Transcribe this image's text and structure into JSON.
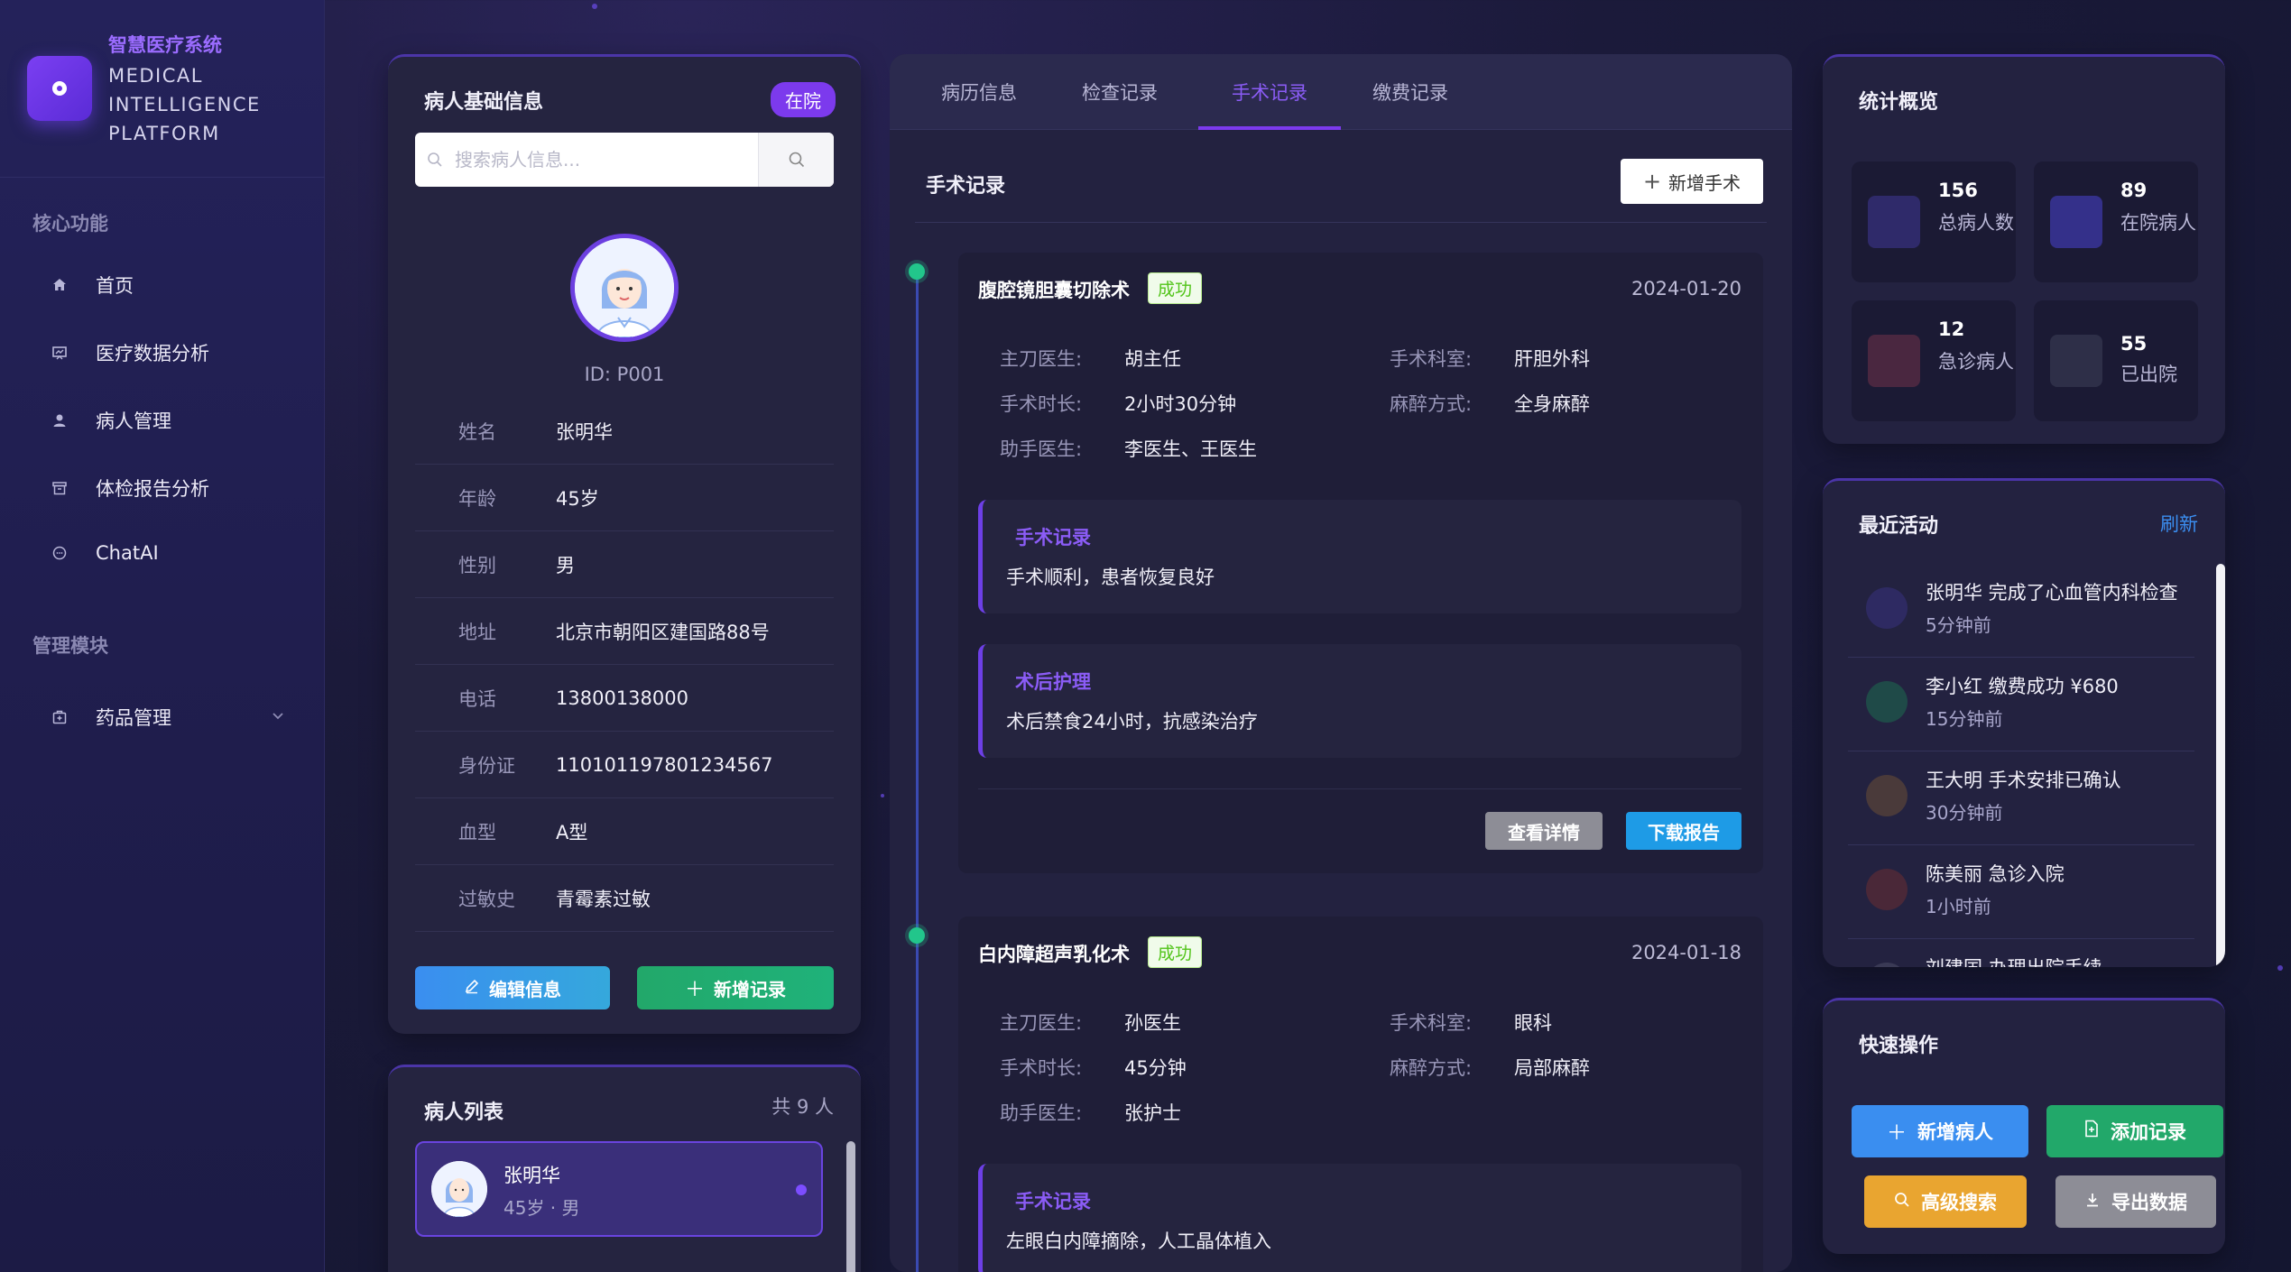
{
  "brand": {
    "title": "智慧医疗系统",
    "subtitle": "MEDICAL INTELLIGENCE PLATFORM"
  },
  "sidebar": {
    "section_core": "核心功能",
    "items": [
      {
        "label": "首页",
        "icon": "home-icon"
      },
      {
        "label": "医疗数据分析",
        "icon": "chart-icon"
      },
      {
        "label": "病人管理",
        "icon": "user-icon"
      },
      {
        "label": "体检报告分析",
        "icon": "report-icon"
      },
      {
        "label": "ChatAI",
        "icon": "chat-icon"
      }
    ],
    "section_manage": "管理模块",
    "manage_items": [
      {
        "label": "药品管理",
        "icon": "medicine-icon"
      }
    ]
  },
  "patient_info": {
    "title": "病人基础信息",
    "status": "在院",
    "search_placeholder": "搜索病人信息...",
    "id": "ID: P001",
    "fields": [
      {
        "k": "姓名",
        "v": "张明华"
      },
      {
        "k": "年龄",
        "v": "45岁"
      },
      {
        "k": "性别",
        "v": "男"
      },
      {
        "k": "地址",
        "v": "北京市朝阳区建国路88号"
      },
      {
        "k": "电话",
        "v": "13800138000"
      },
      {
        "k": "身份证",
        "v": "110101197801234567"
      },
      {
        "k": "血型",
        "v": "A型"
      },
      {
        "k": "过敏史",
        "v": "青霉素过敏"
      }
    ],
    "edit_label": "编辑信息",
    "add_label": "新增记录"
  },
  "patient_list": {
    "title": "病人列表",
    "count": "共 9 人",
    "items": [
      {
        "name": "张明华",
        "meta": "45岁 · 男"
      }
    ]
  },
  "tabs": [
    "病历信息",
    "检查记录",
    "手术记录",
    "缴费记录"
  ],
  "active_tab": "手术记录",
  "surgery": {
    "title": "手术记录",
    "add_label": "新增手术",
    "records": [
      {
        "name": "腹腔镜胆囊切除术",
        "status": "成功",
        "date": "2024-01-20",
        "surgeon_k": "主刀医生:",
        "surgeon": "胡主任",
        "dept_k": "手术科室:",
        "dept": "肝胆外科",
        "duration_k": "手术时长:",
        "duration": "2小时30分钟",
        "anesthesia_k": "麻醉方式:",
        "anesthesia": "全身麻醉",
        "assistant_k": "助手医生:",
        "assistant": "李医生、王医生",
        "note1_title": "手术记录",
        "note1": "手术顺利，患者恢复良好",
        "note2_title": "术后护理",
        "note2": "术后禁食24小时，抗感染治疗",
        "detail_label": "查看详情",
        "download_label": "下载报告"
      },
      {
        "name": "白内障超声乳化术",
        "status": "成功",
        "date": "2024-01-18",
        "surgeon_k": "主刀医生:",
        "surgeon": "孙医生",
        "dept_k": "手术科室:",
        "dept": "眼科",
        "duration_k": "手术时长:",
        "duration": "45分钟",
        "anesthesia_k": "麻醉方式:",
        "anesthesia": "局部麻醉",
        "assistant_k": "助手医生:",
        "assistant": "张护士",
        "note1_title": "手术记录",
        "note1": "左眼白内障摘除，人工晶体植入"
      }
    ]
  },
  "stats": {
    "title": "统计概览",
    "items": [
      {
        "num": "156",
        "label": "总病人数",
        "color": "#2f2a6a"
      },
      {
        "num": "89",
        "label": "在院病人",
        "color": "#34308a"
      },
      {
        "num": "12",
        "label": "急诊病人",
        "color": "#4a2740"
      },
      {
        "num": "55",
        "label": "已出院",
        "color": "#2e2f48"
      }
    ]
  },
  "activity": {
    "title": "最近活动",
    "refresh": "刷新",
    "items": [
      {
        "text": "张明华 完成了心血管内科检查",
        "time": "5分钟前",
        "color": "#2e2a62"
      },
      {
        "text": "李小红 缴费成功 ¥680",
        "time": "15分钟前",
        "color": "#1f4a48"
      },
      {
        "text": "王大明 手术安排已确认",
        "time": "30分钟前",
        "color": "#4a3a3a"
      },
      {
        "text": "陈美丽 急诊入院",
        "time": "1小时前",
        "color": "#4a2838"
      },
      {
        "text": "刘建国 办理出院手续",
        "time": "",
        "color": "#3a3a55"
      }
    ]
  },
  "quick": {
    "title": "快速操作",
    "add_patient": "新增病人",
    "add_record": "添加记录",
    "advanced_search": "高级搜索",
    "export": "导出数据"
  },
  "colors": {
    "accent": "#7c3aed",
    "success": "#22c68b",
    "blue": "#1e9be6",
    "orange": "#e9a530",
    "gray": "#8d8d96"
  }
}
